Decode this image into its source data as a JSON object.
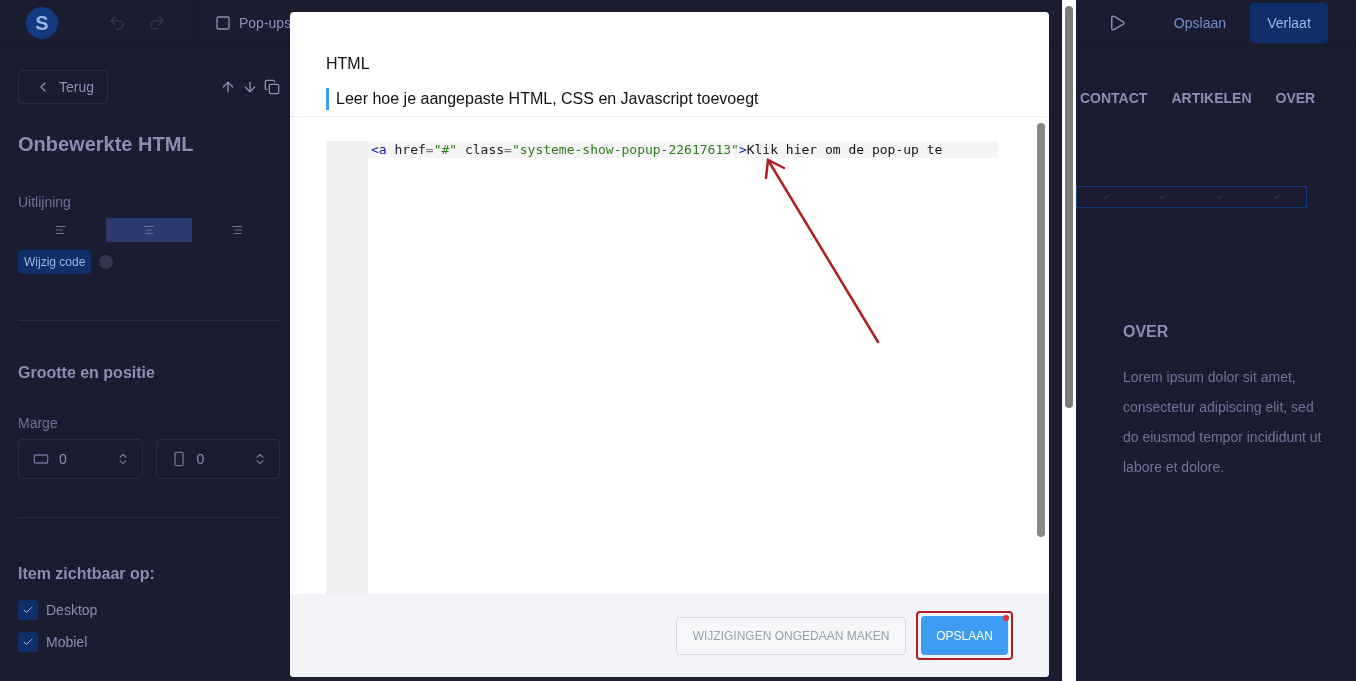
{
  "toolbar": {
    "logo_letter": "S",
    "section": "Pop-ups",
    "save": "Opslaan",
    "exit": "Verlaat"
  },
  "sidebar": {
    "back": "Terug",
    "title": "Onbewerkte HTML",
    "alignment_label": "Uitlijning",
    "alignment": [
      {
        "kind": "left",
        "selected": false
      },
      {
        "kind": "center",
        "selected": true
      },
      {
        "kind": "right",
        "selected": false
      }
    ],
    "edit_code": "Wijzig code",
    "size_title": "Grootte en positie",
    "margin_label": "Marge",
    "margins": [
      {
        "kind": "horizontal",
        "value": "0"
      },
      {
        "kind": "vertical",
        "value": "0"
      }
    ],
    "visibility_title": "Item zichtbaar op:",
    "devices": [
      {
        "label": "Desktop",
        "checked": true
      },
      {
        "label": "Mobiel",
        "checked": true
      }
    ]
  },
  "page_preview": {
    "nav": [
      "CONTACT",
      "ARTIKELEN",
      "OVER"
    ],
    "heading": "OVER",
    "body": "Lorem ipsum dolor sit amet, consectetur adipiscing elit, sed do eiusmod tempor incididunt ut labore et dolore."
  },
  "dialog": {
    "title": "HTML",
    "help_link": "Leer hoe je aangepaste HTML, CSS en Javascript toevoegt",
    "code_line": [
      {
        "kind": "tag",
        "text": "<a"
      },
      {
        "kind": "attr",
        "text": " href"
      },
      {
        "kind": "punct",
        "text": "="
      },
      {
        "kind": "string",
        "text": "\"#\""
      },
      {
        "kind": "attr",
        "text": " class"
      },
      {
        "kind": "punct",
        "text": "="
      },
      {
        "kind": "string",
        "text": "\"systeme-show-popup-22617613\""
      },
      {
        "kind": "tag",
        "text": ">"
      },
      {
        "kind": "text",
        "text": "Klik hier om de pop-up te "
      }
    ],
    "undo_button": "WIJZIGINGEN ONGEDAAN MAKEN",
    "save_button": "OPSLAAN"
  }
}
